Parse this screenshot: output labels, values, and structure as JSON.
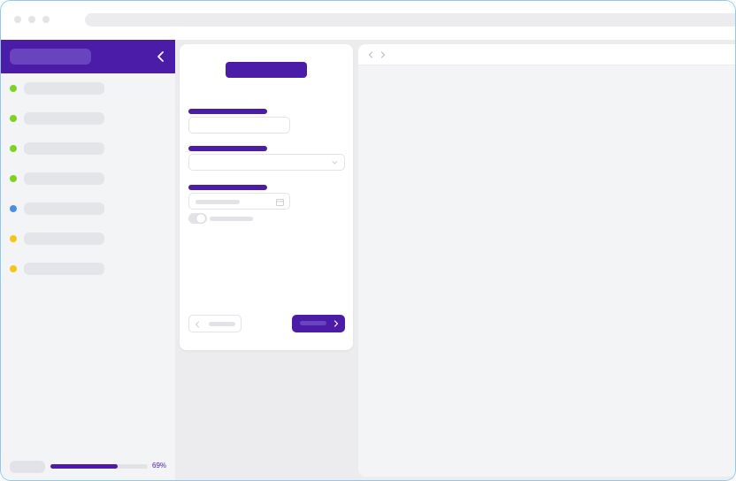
{
  "colors": {
    "accent": "#4b1ca8",
    "status_green": "#7ed321",
    "status_blue": "#4a90e2",
    "status_yellow": "#f5c518"
  },
  "window": {
    "controls": [
      "window-dot",
      "window-dot",
      "window-dot"
    ]
  },
  "sidebar": {
    "collapse_icon": "chevron-left-icon",
    "items": [
      {
        "status": "green"
      },
      {
        "status": "green"
      },
      {
        "status": "green"
      },
      {
        "status": "green"
      },
      {
        "status": "blue"
      },
      {
        "status": "yellow"
      },
      {
        "status": "yellow"
      }
    ],
    "progress": {
      "value": 0.69,
      "label": "69%"
    }
  },
  "form": {
    "select_icon": "chevron-down-icon",
    "date_icon": "calendar-icon",
    "toggle_on": false,
    "back_icon": "chevron-left-icon",
    "next_icon": "chevron-right-icon"
  },
  "browser": {
    "nav_icons": [
      "chevron-left-icon",
      "chevron-right-icon"
    ]
  }
}
